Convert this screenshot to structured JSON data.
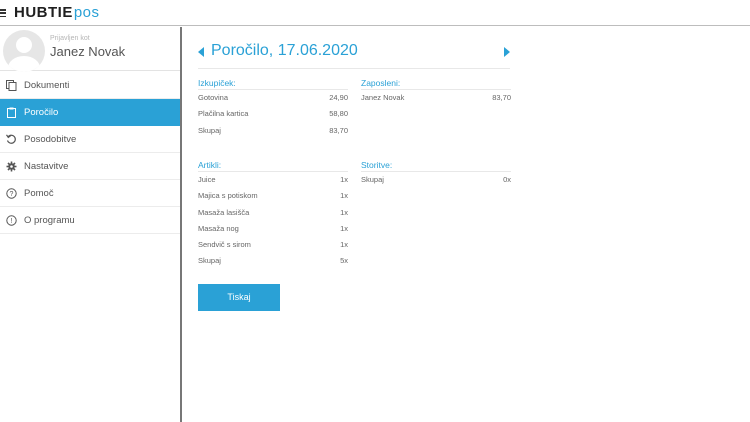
{
  "brand": {
    "name": "HUBTIE",
    "suffix": "pos"
  },
  "user": {
    "label": "Prijavljen kot",
    "name": "Janez Novak"
  },
  "menu": [
    {
      "label": "Dokumenti",
      "icon": "documents-icon"
    },
    {
      "label": "Poročilo",
      "icon": "clipboard-icon",
      "active": true
    },
    {
      "label": "Posodobitve",
      "icon": "refresh-icon"
    },
    {
      "label": "Nastavitve",
      "icon": "gear-icon"
    },
    {
      "label": "Pomoč",
      "icon": "help-icon"
    },
    {
      "label": "O programu",
      "icon": "info-icon"
    }
  ],
  "report": {
    "title": "Poročilo, 17.06.2020",
    "izkupicek": {
      "heading": "Izkupiček:",
      "rows": [
        {
          "label": "Gotovina",
          "value": "24,90"
        },
        {
          "label": "Plačilna kartica",
          "value": "58,80"
        },
        {
          "label": "Skupaj",
          "value": "83,70"
        }
      ]
    },
    "zaposleni": {
      "heading": "Zaposleni:",
      "rows": [
        {
          "label": "Janez Novak",
          "value": "83,70"
        }
      ]
    },
    "artikli": {
      "heading": "Artikli:",
      "rows": [
        {
          "label": "Juice",
          "value": "1x"
        },
        {
          "label": "Majica s potiskom",
          "value": "1x"
        },
        {
          "label": "Masaža lasišča",
          "value": "1x"
        },
        {
          "label": "Masaža nog",
          "value": "1x"
        },
        {
          "label": "Sendvič s sirom",
          "value": "1x"
        },
        {
          "label": "Skupaj",
          "value": "5x"
        }
      ]
    },
    "storitve": {
      "heading": "Storitve:",
      "rows": [
        {
          "label": "Skupaj",
          "value": "0x"
        }
      ]
    },
    "print_label": "Tiskaj"
  },
  "colors": {
    "accent": "#2aa1d6",
    "divider": "#777777"
  }
}
